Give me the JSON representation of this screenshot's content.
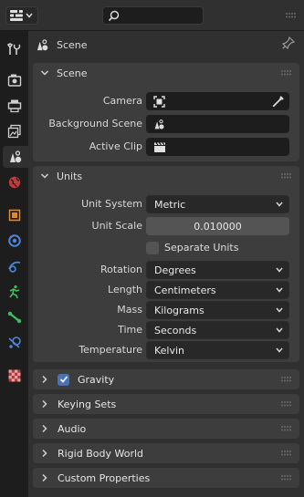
{
  "header": {
    "editor_icon": "properties-editor-icon",
    "search_placeholder": ""
  },
  "tabs": [
    {
      "name": "tool-tab-icon"
    },
    {
      "name": "render-tab-icon"
    },
    {
      "name": "output-tab-icon"
    },
    {
      "name": "view-layer-tab-icon"
    },
    {
      "name": "scene-tab-icon",
      "active": true
    },
    {
      "name": "world-tab-icon"
    },
    {
      "name": "object-tab-icon"
    },
    {
      "name": "modifiers-tab-icon"
    },
    {
      "name": "particles-tab-icon"
    },
    {
      "name": "physics-tab-icon"
    },
    {
      "name": "constraints-tab-icon"
    },
    {
      "name": "data-tab-icon"
    },
    {
      "name": "texture-tab-icon"
    }
  ],
  "context": {
    "title": "Scene"
  },
  "scene_panel": {
    "title": "Scene",
    "camera_label": "Camera",
    "camera_value": "",
    "background_scene_label": "Background Scene",
    "background_scene_value": "",
    "active_clip_label": "Active Clip",
    "active_clip_value": ""
  },
  "units_panel": {
    "title": "Units",
    "unit_system_label": "Unit System",
    "unit_system_value": "Metric",
    "unit_scale_label": "Unit Scale",
    "unit_scale_value": "0.010000",
    "separate_units_label": "Separate Units",
    "separate_units_checked": false,
    "rotation_label": "Rotation",
    "rotation_value": "Degrees",
    "length_label": "Length",
    "length_value": "Centimeters",
    "mass_label": "Mass",
    "mass_value": "Kilograms",
    "time_label": "Time",
    "time_value": "Seconds",
    "temperature_label": "Temperature",
    "temperature_value": "Kelvin"
  },
  "collapsed_panels": {
    "gravity": "Gravity",
    "gravity_checked": true,
    "keying_sets": "Keying Sets",
    "audio": "Audio",
    "rigid_body_world": "Rigid Body World",
    "custom_properties": "Custom Properties"
  },
  "colors": {
    "background": "#303030",
    "panel": "#3d3d3d",
    "field_dark": "#1d1d1d",
    "accent_blue": "#4772b3"
  }
}
